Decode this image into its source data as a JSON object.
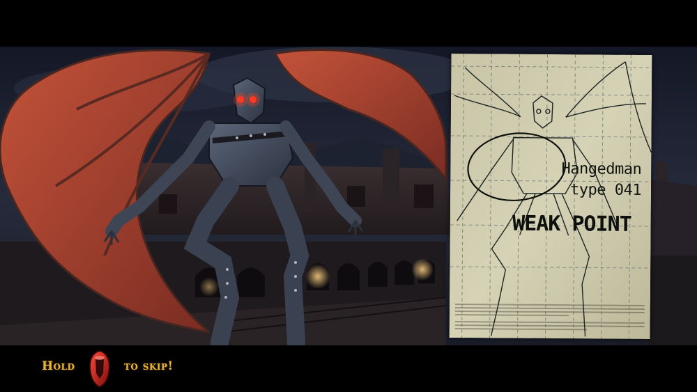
{
  "hud": {
    "hold_label": "Hold",
    "skip_label": "to skip!",
    "button_icon": "red-controller-button-icon",
    "accent_color": "#e8b83a"
  },
  "document": {
    "name_line1": "Hangedman",
    "name_line2": "type 041",
    "weak_point": "WEAK POINT"
  },
  "scene": {
    "creature_icon": "winged-hangedman-creature",
    "eye_color": "#ff3a20",
    "wing_color": "#b8442a"
  }
}
